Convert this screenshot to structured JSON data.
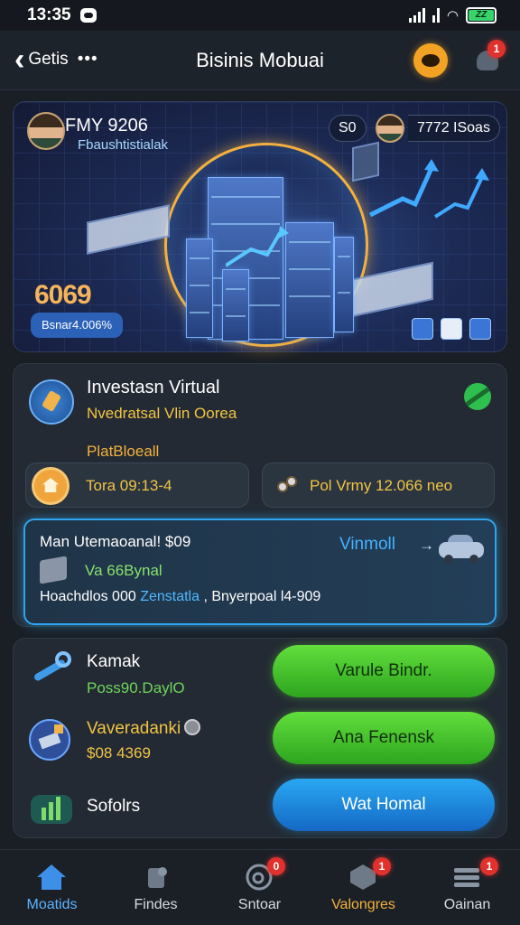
{
  "status_bar": {
    "time": "13:35"
  },
  "header": {
    "back_label": "Getis",
    "more": "•••",
    "title": "Bisinis Mobuai",
    "notif_count": "1"
  },
  "hero": {
    "name": "FMY 9206",
    "subtitle": "Fbaushtistialak",
    "chip_left": "S0",
    "chip_right": "7772 ISoas",
    "big_value": "6069",
    "pill": "Bsnar4.006%"
  },
  "invest": {
    "title": "Investasn Virtual",
    "subtitle": "Nvedratsal Vlin Oorea",
    "label": "PlatBloeall",
    "pill_left": "Tora 09:13-4",
    "pill_right": "Pol Vrmy 12.066 neo",
    "hl_title": "Man Utemaoanal!  $09",
    "hl_link": "Vinmoll",
    "hl_arrow": "→",
    "hl_value": "Va 66Bynal",
    "hl_line_a": "Hoachdlos  000 ",
    "hl_line_b": "Zenstatla",
    "hl_line_c": " , Bnyerpoal l4-909"
  },
  "actions": {
    "item1_title": "Kamak",
    "item1_sub": "Poss90.DaylO",
    "item2_title": "Vaveradanki",
    "item2_sub": "$08  4369",
    "item3_title": "Sofolrs",
    "btn1": "Varule Bindr.",
    "btn2": "Ana Fenensk",
    "btn3": "Wat Homal"
  },
  "nav": [
    {
      "label": "Moatids"
    },
    {
      "label": "Findes"
    },
    {
      "label": "Sntoar",
      "badge": "0"
    },
    {
      "label": "Valongres",
      "badge": "1"
    },
    {
      "label": "Oainan",
      "badge": "1"
    }
  ],
  "colors": {
    "accent_blue": "#2ea6ef",
    "green": "#4fcf34",
    "orange": "#f3b13d",
    "bg": "#1a1f26"
  }
}
